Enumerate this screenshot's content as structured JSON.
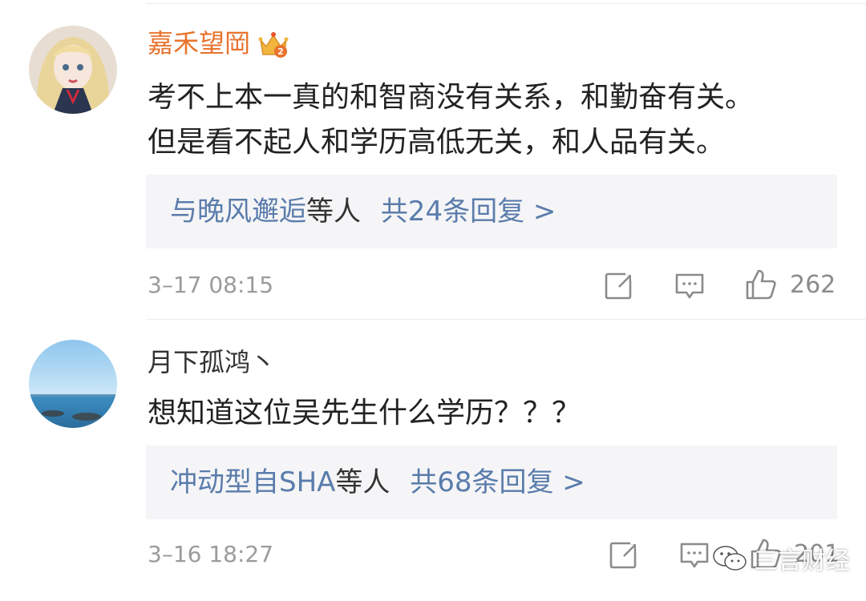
{
  "comments": [
    {
      "username": "嘉禾望岡",
      "badge": "crown-vip-icon",
      "text_lines": [
        "考不上本一真的和智商没有关系，和勤奋有关。",
        "但是看不起人和学历高低无关，和人品有关。"
      ],
      "reply_prefix": "与晚风邂逅",
      "reply_mid": "等人",
      "reply_suffix": "共24条回复 >",
      "time": "3–17 08:15",
      "likes": "262"
    },
    {
      "username": "月下孤鸿丶",
      "text_lines": [
        "想知道这位吴先生什么学历？？？"
      ],
      "reply_prefix": "冲动型自SHA",
      "reply_mid": "等人",
      "reply_suffix": "共68条回复 >",
      "time": "3–16 18:27",
      "likes": "201"
    }
  ],
  "watermark": "三言财经",
  "colors": {
    "vip_name": "#e8732d",
    "reply_link": "#5a7cab",
    "reply_bg": "#f5f5f7"
  }
}
